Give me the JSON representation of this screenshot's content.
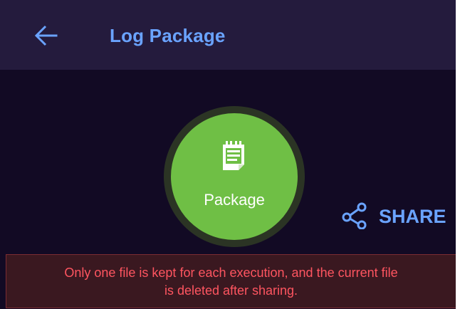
{
  "header": {
    "title": "Log Package",
    "back_icon": "arrow-left-icon"
  },
  "main": {
    "package_button": {
      "label": "Package",
      "icon": "notepad-icon"
    },
    "share_button": {
      "label": "SHARE",
      "icon": "share-icon"
    }
  },
  "notice": {
    "line1": "Only one file is kept for each execution, and the current file",
    "line2": "is deleted after sharing."
  },
  "colors": {
    "header_bg": "#241b3d",
    "screen_bg": "#120a24",
    "accent_blue": "#6aa3ff",
    "package_green": "#6fbf45",
    "warning_red": "#ff5560"
  }
}
